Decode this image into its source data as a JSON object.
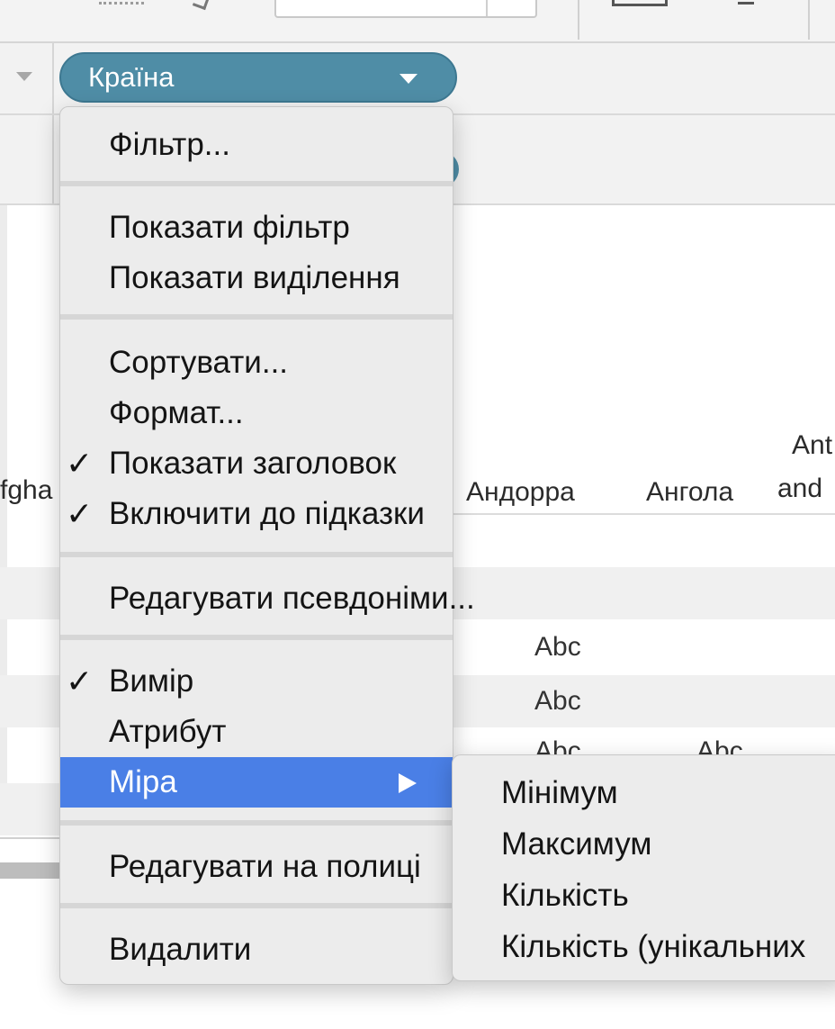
{
  "pill": {
    "label": "Країна"
  },
  "table": {
    "headers": [
      "fgha",
      "Андорра",
      "Ангола",
      "Ant",
      "and"
    ],
    "cells": [
      "Abc",
      "Abc",
      "Abc",
      "Abc"
    ]
  },
  "menu": {
    "items": [
      {
        "label": "Фільтр...",
        "checked": false
      },
      {
        "label": "Показати фільтр",
        "checked": false
      },
      {
        "label": "Показати виділення",
        "checked": false
      },
      {
        "label": "Сортувати...",
        "checked": false
      },
      {
        "label": "Формат...",
        "checked": false
      },
      {
        "label": "Показати заголовок",
        "checked": true
      },
      {
        "label": "Включити до підказки",
        "checked": true
      },
      {
        "label": "Редагувати псевдоніми...",
        "checked": false
      },
      {
        "label": "Вимір",
        "checked": true
      },
      {
        "label": "Атрибут",
        "checked": false
      },
      {
        "label": "Міра",
        "checked": false,
        "highlighted": true,
        "has_submenu": true
      },
      {
        "label": "Редагувати на полиці",
        "checked": false
      },
      {
        "label": "Видалити",
        "checked": false
      }
    ],
    "check_glyph": "✓"
  },
  "submenu": {
    "items": [
      "Мінімум",
      "Максимум",
      "Кількість",
      "Кількість (унікальних"
    ]
  },
  "colors": {
    "pill": "#4f8da6",
    "highlight": "#4a7fe6",
    "menu_bg": "#ececec"
  },
  "icons": [
    "shelf-dropdown-icon",
    "pill-dropdown-icon",
    "checkmark-icon",
    "submenu-arrow-icon"
  ]
}
